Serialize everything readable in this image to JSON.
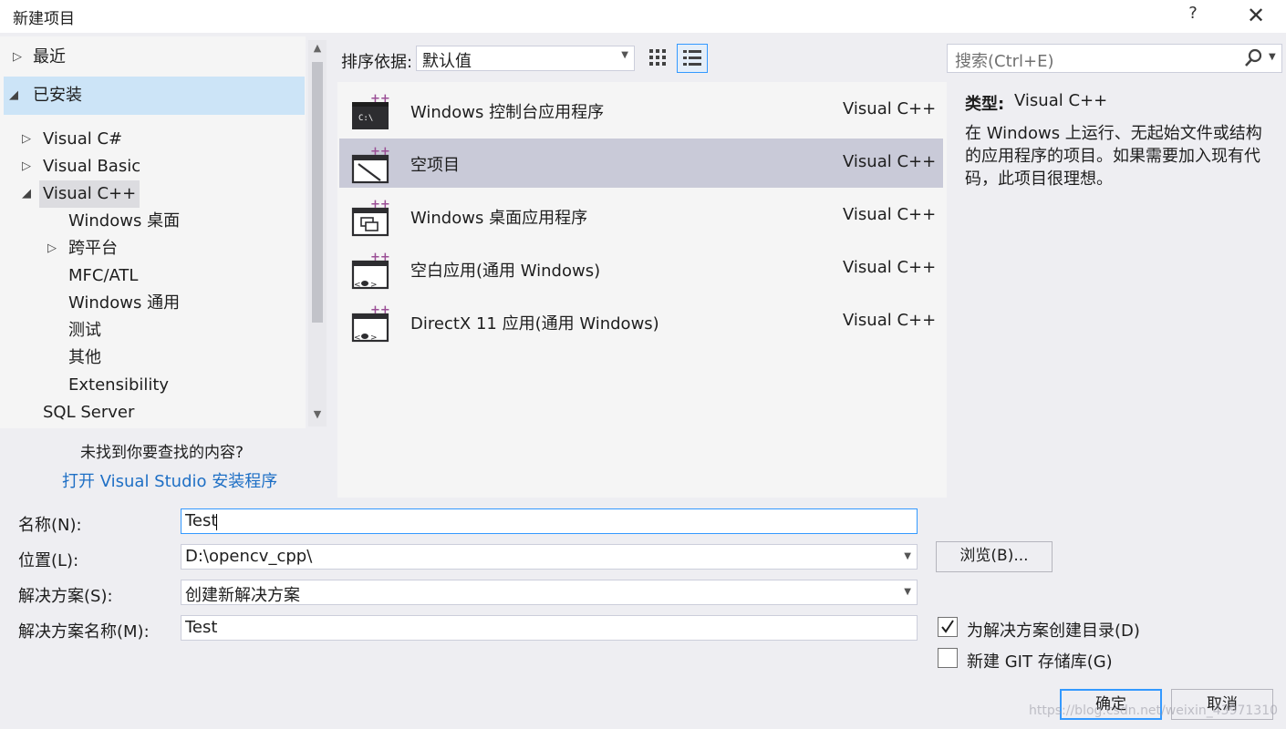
{
  "window": {
    "title": "新建项目",
    "help": "?",
    "close": "✕"
  },
  "tree": {
    "recent": "最近",
    "installed": "已安装",
    "items": [
      {
        "label": "Visual C#"
      },
      {
        "label": "Visual Basic"
      },
      {
        "label": "Visual C++"
      },
      {
        "label": "Windows 桌面"
      },
      {
        "label": "跨平台"
      },
      {
        "label": "MFC/ATL"
      },
      {
        "label": "Windows 通用"
      },
      {
        "label": "测试"
      },
      {
        "label": "其他"
      },
      {
        "label": "Extensibility"
      },
      {
        "label": "SQL Server"
      }
    ],
    "not_found": "未找到你要查找的内容?",
    "install_link": "打开 Visual Studio 安装程序"
  },
  "toolbar": {
    "sort_label": "排序依据:",
    "sort_value": "默认值",
    "search_placeholder": "搜索(Ctrl+E)"
  },
  "templates": [
    {
      "name": "Windows 控制台应用程序",
      "lang": "Visual C++",
      "icon": "console-app-icon"
    },
    {
      "name": "空项目",
      "lang": "Visual C++",
      "icon": "empty-project-icon"
    },
    {
      "name": "Windows 桌面应用程序",
      "lang": "Visual C++",
      "icon": "desktop-app-icon"
    },
    {
      "name": "空白应用(通用 Windows)",
      "lang": "Visual C++",
      "icon": "blank-uwp-app-icon"
    },
    {
      "name": "DirectX 11 应用(通用 Windows)",
      "lang": "Visual C++",
      "icon": "directx-app-icon"
    }
  ],
  "selected_template": 1,
  "description": {
    "type_label": "类型:",
    "type_value": "Visual C++",
    "text": "在 Windows 上运行、无起始文件或结构的应用程序的项目。如果需要加入现有代码，此项目很理想。"
  },
  "form": {
    "name_label": "名称(N):",
    "name_value": "Test",
    "location_label": "位置(L):",
    "location_value": "D:\\opencv_cpp\\",
    "browse": "浏览(B)...",
    "solution_label": "解决方案(S):",
    "solution_value": "创建新解决方案",
    "solution_name_label": "解决方案名称(M):",
    "solution_name_value": "Test",
    "create_dir_label": "为解决方案创建目录(D)",
    "create_dir_checked": true,
    "git_label": "新建 GIT 存储库(G)",
    "git_checked": false
  },
  "buttons": {
    "ok": "确定",
    "cancel": "取消"
  },
  "watermark": "https://blog.csdn.net/weixin_43971310",
  "colors": {
    "accent": "#3399ff",
    "plus_purple": "#9b4f96",
    "selection": "#c9cad8",
    "link": "#1e6fc5"
  }
}
